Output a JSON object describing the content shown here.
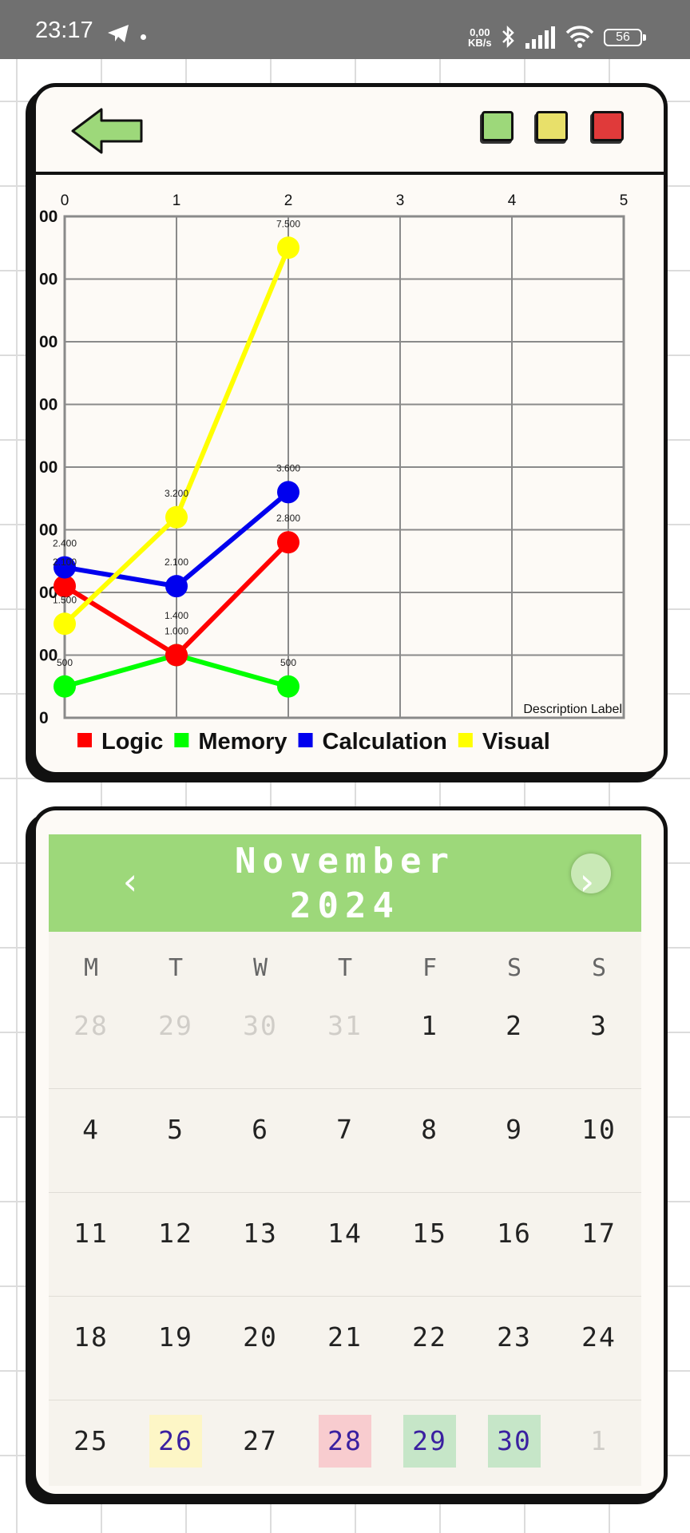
{
  "status_bar": {
    "time": "23:17",
    "net_rate_top": "0,00",
    "net_rate_bottom": "KB/s",
    "battery": "56"
  },
  "toolbar": {
    "back_icon": "arrow-left-icon",
    "color_buttons": [
      {
        "name": "green",
        "color": "#9dd87a"
      },
      {
        "name": "yellow",
        "color": "#e8e06a"
      },
      {
        "name": "red",
        "color": "#e03a3a"
      }
    ]
  },
  "chart_data": {
    "type": "line",
    "x_ticks": [
      "0",
      "1",
      "2",
      "3",
      "4",
      "5"
    ],
    "xlim": [
      0,
      5
    ],
    "ylim": [
      0,
      8
    ],
    "y_tick_labels": [
      "0",
      "00",
      "00",
      "00",
      "00",
      "00",
      "00",
      "00",
      "00"
    ],
    "description_label": "Description Label",
    "grid": true,
    "legend_position": "bottom-left",
    "series": [
      {
        "name": "Logic",
        "color": "#ff0000",
        "x": [
          0,
          1,
          2
        ],
        "y": [
          2.1,
          1.0,
          2.8
        ],
        "labels": [
          "2.100",
          "1.000",
          "2.800"
        ]
      },
      {
        "name": "Memory",
        "color": "#00ff00",
        "x": [
          0,
          1,
          2
        ],
        "y": [
          0.5,
          1.0,
          0.5
        ],
        "labels": [
          "500",
          "",
          "500"
        ]
      },
      {
        "name": "Calculation",
        "color": "#0000ee",
        "x": [
          0,
          1,
          2
        ],
        "y": [
          2.4,
          2.1,
          3.6
        ],
        "labels": [
          "2.400",
          "2.100",
          "3.600"
        ]
      },
      {
        "name": "Visual",
        "color": "#ffff00",
        "x": [
          0,
          1,
          2
        ],
        "y": [
          1.5,
          3.2,
          7.5
        ],
        "labels": [
          "1.500",
          "3.200",
          "7.500"
        ]
      }
    ],
    "extra_point_label": {
      "x": 1,
      "y": 1.4,
      "text": "1.400"
    }
  },
  "calendar": {
    "month": "November",
    "year": "2024",
    "prev_label": "‹",
    "next_label": "›",
    "weekdays": [
      "M",
      "T",
      "W",
      "T",
      "F",
      "S",
      "S"
    ],
    "weeks": [
      [
        {
          "d": "28",
          "m": true
        },
        {
          "d": "29",
          "m": true
        },
        {
          "d": "30",
          "m": true
        },
        {
          "d": "31",
          "m": true
        },
        {
          "d": "1"
        },
        {
          "d": "2"
        },
        {
          "d": "3"
        }
      ],
      [
        {
          "d": "4"
        },
        {
          "d": "5"
        },
        {
          "d": "6"
        },
        {
          "d": "7"
        },
        {
          "d": "8"
        },
        {
          "d": "9"
        },
        {
          "d": "10"
        }
      ],
      [
        {
          "d": "11"
        },
        {
          "d": "12"
        },
        {
          "d": "13"
        },
        {
          "d": "14"
        },
        {
          "d": "15"
        },
        {
          "d": "16"
        },
        {
          "d": "17"
        }
      ],
      [
        {
          "d": "18"
        },
        {
          "d": "19"
        },
        {
          "d": "20"
        },
        {
          "d": "21"
        },
        {
          "d": "22"
        },
        {
          "d": "23"
        },
        {
          "d": "24"
        }
      ],
      [
        {
          "d": "25"
        },
        {
          "d": "26",
          "hl": "#fdf6c6"
        },
        {
          "d": "27"
        },
        {
          "d": "28",
          "hl": "#f8cccf"
        },
        {
          "d": "29",
          "hl": "#c6e6c8"
        },
        {
          "d": "30",
          "hl": "#c6e6c8"
        },
        {
          "d": "1",
          "m": true
        }
      ]
    ]
  }
}
